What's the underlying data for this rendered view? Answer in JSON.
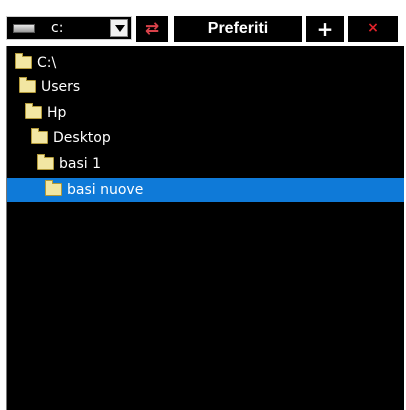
{
  "toolbar": {
    "drive_value": "c:",
    "refresh_icon": "refresh-icon",
    "favorites_label": "Preferiti",
    "add_label": "+",
    "delete_label": "×"
  },
  "tree": {
    "nodes": [
      {
        "label": "C:\\",
        "icon": "folder-icon"
      },
      {
        "label": "Users",
        "icon": "folder-icon"
      },
      {
        "label": "Hp",
        "icon": "folder-icon"
      },
      {
        "label": "Desktop",
        "icon": "folder-icon"
      },
      {
        "label": "basi 1",
        "icon": "folder-icon"
      },
      {
        "label": "basi nuove",
        "icon": "folder-icon",
        "selected": true
      }
    ]
  },
  "colors": {
    "background": "#000000",
    "selection": "#0f7ad8",
    "delete": "#e0222a",
    "refresh": "#d9424a",
    "folder": "#f2e6a2"
  }
}
